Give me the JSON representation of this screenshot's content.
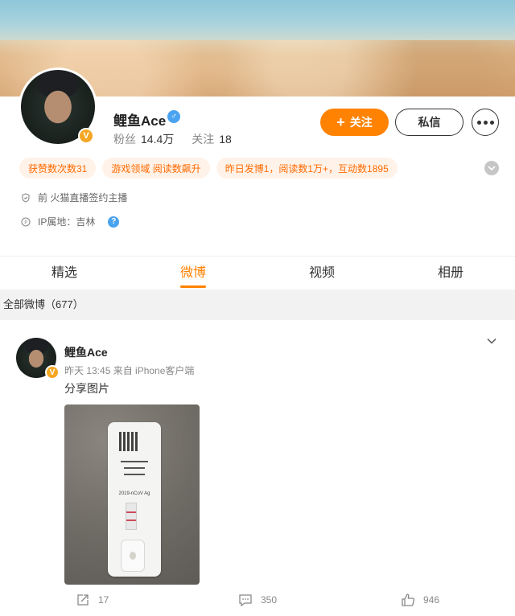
{
  "profile": {
    "name": "鲤鱼Ace",
    "verified_badge": "V",
    "gender_icon": "♂",
    "fans_label": "粉丝",
    "fans_value": "14.4万",
    "following_label": "关注",
    "following_value": "18"
  },
  "buttons": {
    "follow_plus": "+",
    "follow_label": "关注",
    "message_label": "私信"
  },
  "tags": [
    "获赞数次数31",
    "游戏领域 阅读数飙升",
    "昨日发博1，阅读数1万+，互动数1895"
  ],
  "info": {
    "title": "前 火猫直播签约主播",
    "ip": "IP属地：吉林",
    "help": "?"
  },
  "tabs": [
    "精选",
    "微博",
    "视频",
    "相册"
  ],
  "active_tab": "微博",
  "section": {
    "label": "全部微博（677）"
  },
  "post": {
    "author": "鲤鱼Ace",
    "meta": "昨天 13:45  来自 iPhone客户端",
    "text": "分享图片",
    "image_text": "2019-nCoV Ag",
    "repost_count": "17",
    "comment_count": "350",
    "like_count": "946"
  },
  "colors": {
    "accent": "#ff8200",
    "tag_bg": "#fff2e8",
    "tag_text": "#ff6a00",
    "verified": "#f5a623"
  }
}
